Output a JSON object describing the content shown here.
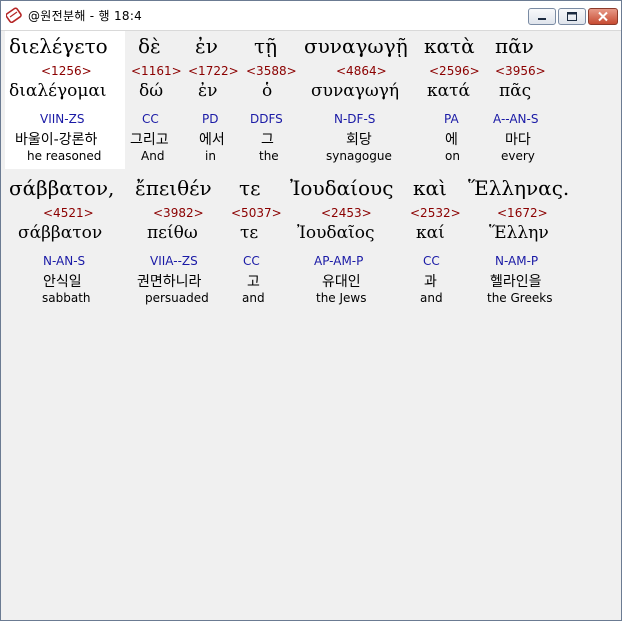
{
  "window": {
    "title": "@원전분해 - 행 18:4",
    "icon": "app-icon"
  },
  "colors": {
    "strong": "#8b0000",
    "morph": "#1a1aa6",
    "highlight": "#ffffff"
  },
  "rows": [
    {
      "words": [
        {
          "greek": "διελέγετο",
          "strong": "<1256>",
          "lemma": "διαλέγομαι",
          "morph": "VIIN-ZS",
          "korean": "바울이-강론하",
          "english": "he reasoned"
        },
        {
          "greek": "δὲ",
          "strong": "<1161>",
          "lemma": "δώ",
          "morph": "CC",
          "korean": "그리고",
          "english": "And"
        },
        {
          "greek": "ἐν",
          "strong": "<1722>",
          "lemma": "ἐν",
          "morph": "PD",
          "korean": "에서",
          "english": "in"
        },
        {
          "greek": "τῇ",
          "strong": "<3588>",
          "lemma": "ὁ",
          "morph": "DDFS",
          "korean": "그",
          "english": "the"
        },
        {
          "greek": "συναγωγῇ",
          "strong": "<4864>",
          "lemma": "συναγωγή",
          "morph": "N-DF-S",
          "korean": "회당",
          "english": "synagogue"
        },
        {
          "greek": "κατὰ",
          "strong": "<2596>",
          "lemma": "κατά",
          "morph": "PA",
          "korean": "에",
          "english": "on"
        },
        {
          "greek": "πᾶν",
          "strong": "<3956>",
          "lemma": "πᾶς",
          "morph": "A--AN-S",
          "korean": "마다",
          "english": "every"
        }
      ]
    },
    {
      "words": [
        {
          "greek": "σάββατον,",
          "strong": "<4521>",
          "lemma": "σάββατον",
          "morph": "N-AN-S",
          "korean": "안식일",
          "english": "sabbath"
        },
        {
          "greek": "ἔπειθέν",
          "strong": "<3982>",
          "lemma": "πείθω",
          "morph": "VIIA--ZS",
          "korean": "권면하니라",
          "english": "persuaded"
        },
        {
          "greek": "τε",
          "strong": "<5037>",
          "lemma": "τε",
          "morph": "CC",
          "korean": "고",
          "english": "and"
        },
        {
          "greek": "Ἰουδαίους",
          "strong": "<2453>",
          "lemma": "Ἰουδαῖος",
          "morph": "AP-AM-P",
          "korean": "유대인",
          "english": "the Jews"
        },
        {
          "greek": "καὶ",
          "strong": "<2532>",
          "lemma": "καί",
          "morph": "CC",
          "korean": "과",
          "english": "and"
        },
        {
          "greek": "Ἕλληνας.",
          "strong": "<1672>",
          "lemma": "Ἕλλην",
          "morph": "N-AM-P",
          "korean": "헬라인을",
          "english": "the Greeks"
        }
      ]
    }
  ]
}
